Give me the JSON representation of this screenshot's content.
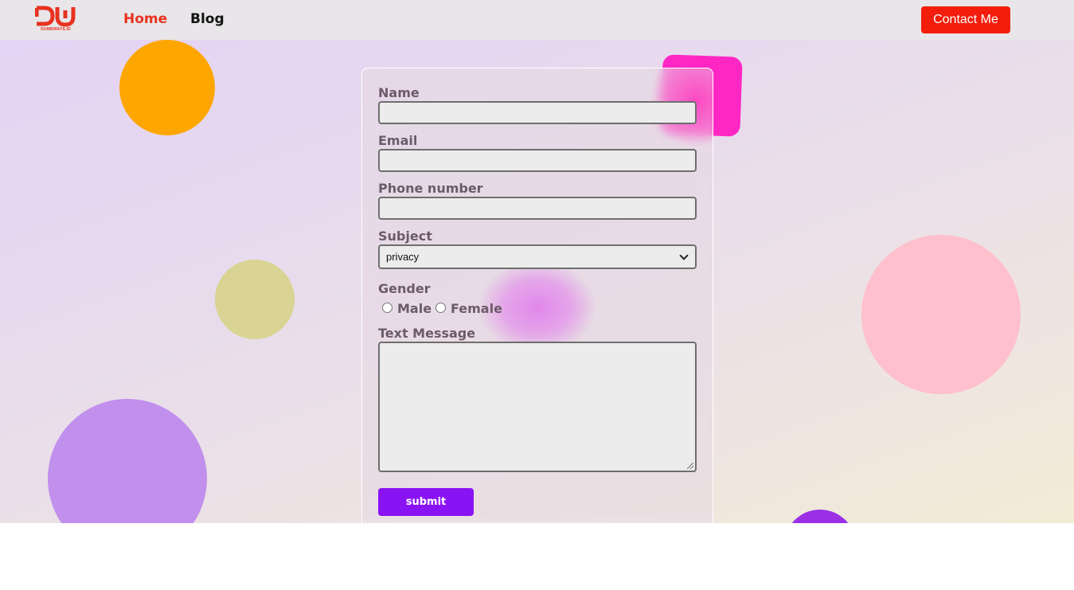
{
  "nav": {
    "logo_text": "DUMBWAYS.ID",
    "home_label": "Home",
    "blog_label": "Blog",
    "contact_label": "Contact Me"
  },
  "form": {
    "name_label": "Name",
    "email_label": "Email",
    "phone_label": "Phone number",
    "subject_label": "Subject",
    "subject_selected": "privacy",
    "gender_label": "Gender",
    "gender_male": "Male",
    "gender_female": "Female",
    "message_label": "Text Message",
    "submit_label": "submit",
    "name_value": "",
    "email_value": "",
    "phone_value": ""
  },
  "colors": {
    "accent_red": "#f21d0b",
    "submit_purple": "#8a13f4",
    "nav_background": "#e8e6e8"
  },
  "icons": [
    "logo-icon",
    "chevron-down-icon",
    "resize-grip-icon"
  ]
}
